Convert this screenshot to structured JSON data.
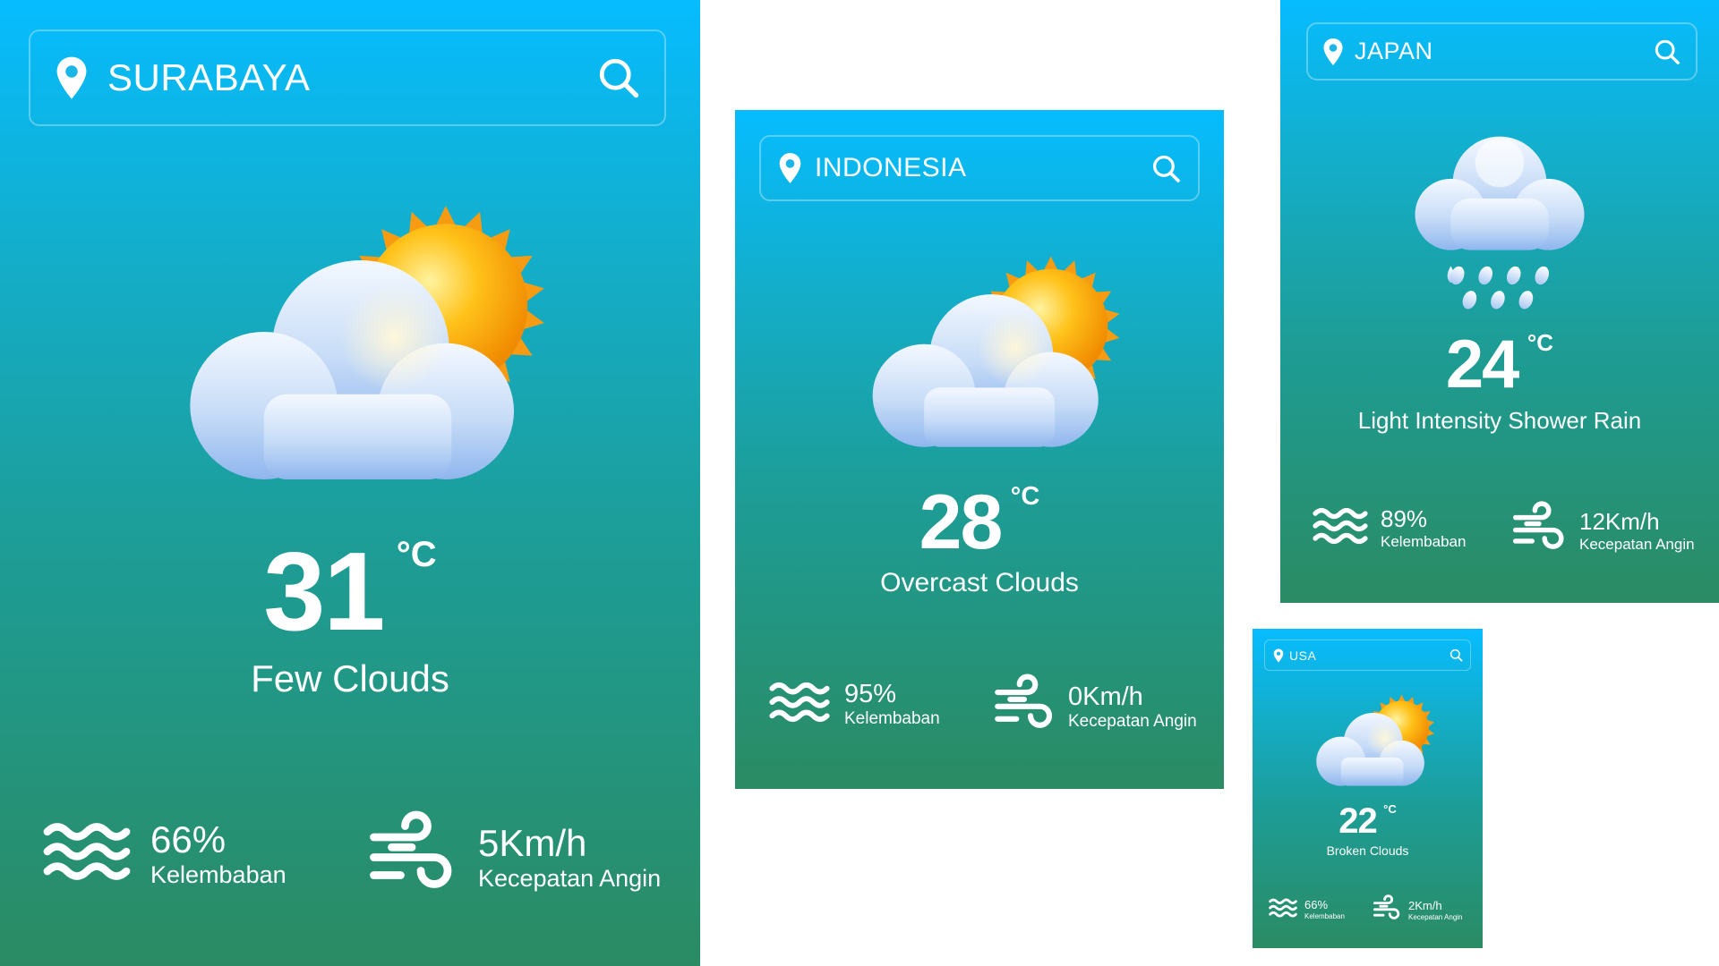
{
  "cards": [
    {
      "location": "SURABAYA",
      "temperature": "31",
      "unit": "°C",
      "condition": "Few Clouds",
      "humidity_value": "66%",
      "humidity_label": "Kelembaban",
      "wind_value": "5Km/h",
      "wind_label": "Kecepatan Angin",
      "icon": "few-clouds-icon"
    },
    {
      "location": "INDONESIA",
      "temperature": "28",
      "unit": "°C",
      "condition": "Overcast Clouds",
      "humidity_value": "95%",
      "humidity_label": "Kelembaban",
      "wind_value": "0Km/h",
      "wind_label": "Kecepatan Angin",
      "icon": "cloud-sun-icon"
    },
    {
      "location": "JAPAN",
      "temperature": "24",
      "unit": "°C",
      "condition": "Light Intensity Shower Rain",
      "humidity_value": "89%",
      "humidity_label": "Kelembaban",
      "wind_value": "12Km/h",
      "wind_label": "Kecepatan Angin",
      "icon": "rain-cloud-icon"
    },
    {
      "location": "USA",
      "temperature": "22",
      "unit": "°C",
      "condition": "Broken Clouds",
      "humidity_value": "66%",
      "humidity_label": "Kelembaban",
      "wind_value": "2Km/h",
      "wind_label": "Kecepatan Angin",
      "icon": "cloud-sun-icon"
    }
  ],
  "colors": {
    "gradient_top": "#06bcff",
    "gradient_bottom": "#2a8b63",
    "text": "#ffffff"
  }
}
